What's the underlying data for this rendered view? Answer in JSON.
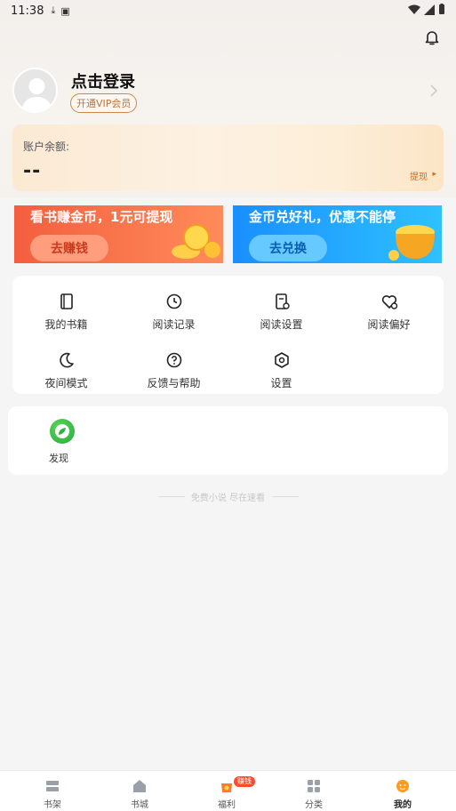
{
  "status_bar": {
    "time": "11:38"
  },
  "profile": {
    "login_title": "点击登录",
    "vip_label": "开通VIP会员"
  },
  "balance": {
    "label": "账户余额:",
    "value": "--",
    "withdraw": "提现"
  },
  "banners": [
    {
      "title": "看书赚金币，1元可提现",
      "button": "去赚钱"
    },
    {
      "title": "金币兑好礼，优惠不能停",
      "button": "去兑换"
    }
  ],
  "menu": [
    {
      "label": "我的书籍",
      "icon": "book-icon"
    },
    {
      "label": "阅读记录",
      "icon": "clock-icon"
    },
    {
      "label": "阅读设置",
      "icon": "reading-settings-icon"
    },
    {
      "label": "阅读偏好",
      "icon": "heart-settings-icon"
    },
    {
      "label": "夜间模式",
      "icon": "moon-icon"
    },
    {
      "label": "反馈与帮助",
      "icon": "question-icon"
    },
    {
      "label": "设置",
      "icon": "hexagon-gear-icon"
    }
  ],
  "discover": {
    "label": "发现",
    "icon": "compass-icon"
  },
  "footer_note": "免费小说 尽在速看",
  "tabs": [
    {
      "label": "书架",
      "icon": "bookshelf-icon"
    },
    {
      "label": "书城",
      "icon": "home-icon"
    },
    {
      "label": "福利",
      "icon": "gift-bag-icon",
      "badge": "赚钱"
    },
    {
      "label": "分类",
      "icon": "category-grid-icon"
    },
    {
      "label": "我的",
      "icon": "profile-face-icon",
      "active": true
    }
  ],
  "colors": {
    "accent_orange": "#f35f3e",
    "accent_blue": "#1a8fff",
    "vip_brown": "#b8743c",
    "active_tab": "#ff9a1f"
  }
}
